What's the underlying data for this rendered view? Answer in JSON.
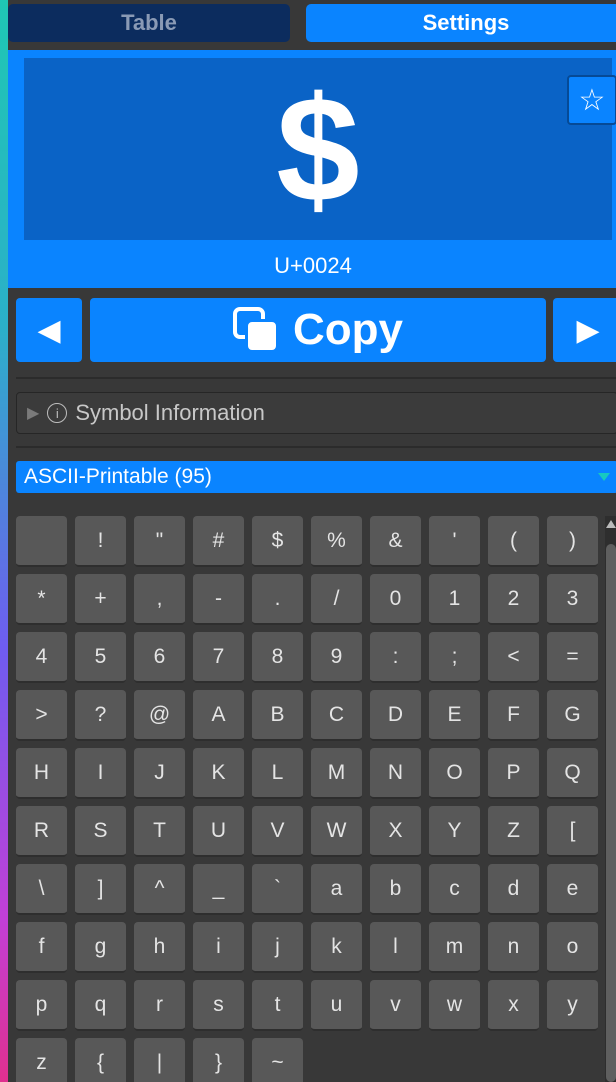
{
  "tabs": {
    "table": "Table",
    "settings": "Settings"
  },
  "preview": {
    "glyph": "$",
    "codepoint": "U+0024",
    "favorite_icon": "☆"
  },
  "actions": {
    "prev": "◀",
    "copy": "Copy",
    "next": "▶"
  },
  "foldout": {
    "label": "Symbol Information",
    "info": "i"
  },
  "dropdown": {
    "selected": "ASCII-Printable (95)"
  },
  "grid": {
    "cells": [
      " ",
      "!",
      "\"",
      "#",
      "$",
      "%",
      "&",
      "'",
      "(",
      ")",
      "*",
      "+",
      ",",
      "-",
      ".",
      "/",
      "0",
      "1",
      "2",
      "3",
      "4",
      "5",
      "6",
      "7",
      "8",
      "9",
      ":",
      ";",
      "<",
      "=",
      ">",
      "?",
      "@",
      "A",
      "B",
      "C",
      "D",
      "E",
      "F",
      "G",
      "H",
      "I",
      "J",
      "K",
      "L",
      "M",
      "N",
      "O",
      "P",
      "Q",
      "R",
      "S",
      "T",
      "U",
      "V",
      "W",
      "X",
      "Y",
      "Z",
      "[",
      "\\",
      "]",
      "^",
      "_",
      "`",
      "a",
      "b",
      "c",
      "d",
      "e",
      "f",
      "g",
      "h",
      "i",
      "j",
      "k",
      "l",
      "m",
      "n",
      "o",
      "p",
      "q",
      "r",
      "s",
      "t",
      "u",
      "v",
      "w",
      "x",
      "y",
      "z",
      "{",
      "|",
      "}",
      "~"
    ]
  },
  "colors": {
    "accent": "#0a84ff",
    "preview_inner": "#0a63c6",
    "tab_inactive": "#0c2c5e",
    "panel_bg": "#383838",
    "cell_bg": "#585858"
  }
}
